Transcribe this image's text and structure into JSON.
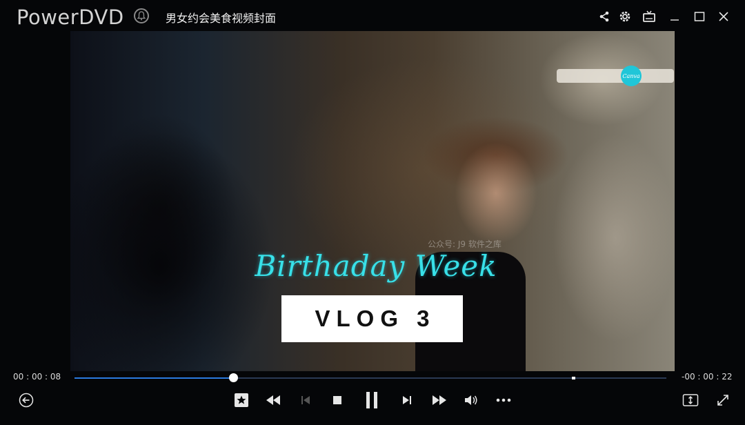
{
  "app": {
    "brand": "PowerDVD",
    "title": "男女约会美食视频封面"
  },
  "window_controls": {
    "share_icon": "share-icon",
    "settings_icon": "gear-icon",
    "tv_icon": "tv-icon",
    "minimize_icon": "minimize-icon",
    "maximize_icon": "maximize-icon",
    "close_icon": "close-icon"
  },
  "video": {
    "overlay_title": "Birthaday Week",
    "overlay_subtitle": "VLOG 3",
    "badge_text": "Canva",
    "watermark_text": "公众号: J9 软件之库"
  },
  "playback": {
    "elapsed": "00 : 00 : 08",
    "remaining": "-00 : 00 : 22",
    "progress_fraction": 0.268,
    "chapter_marker_fraction": 0.84
  },
  "controls": {
    "back_icon": "back-arrow-icon",
    "bookmark_icon": "bookmark-star-icon",
    "rewind_icon": "rewind-icon",
    "prev_icon": "previous-chapter-icon",
    "stop_icon": "stop-icon",
    "pause_icon": "pause-icon",
    "next_icon": "next-chapter-icon",
    "fast_forward_icon": "fast-forward-icon",
    "volume_icon": "volume-icon",
    "more_icon": "more-icon",
    "fit_icon": "fit-screen-icon",
    "fullscreen_icon": "fullscreen-icon"
  },
  "colors": {
    "accent": "#2b7be0",
    "overlay_text": "#38e0e8",
    "background": "#050608"
  }
}
